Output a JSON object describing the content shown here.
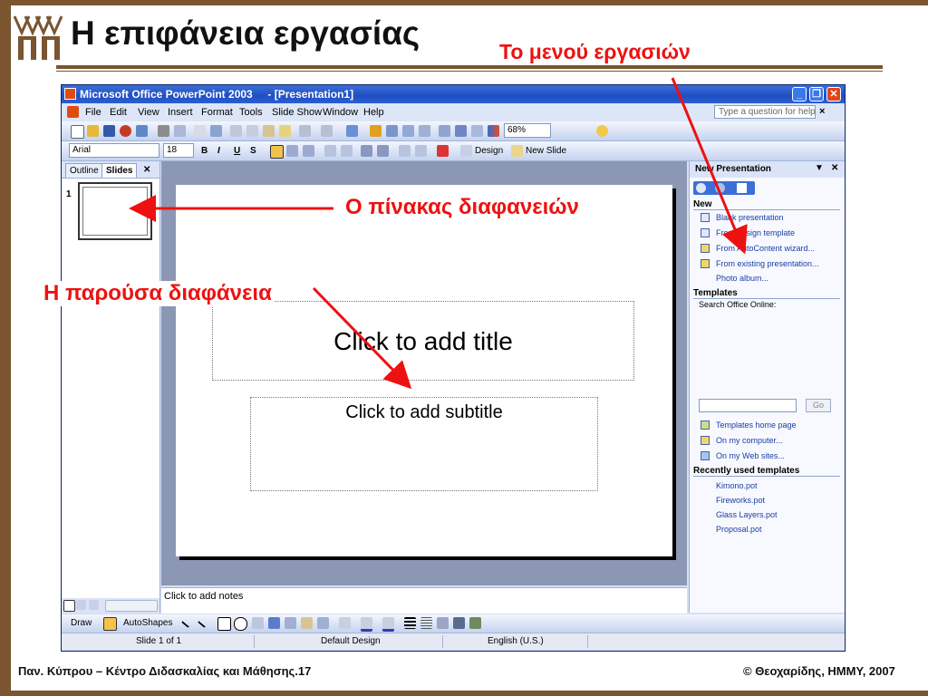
{
  "slide": {
    "heading": "Η επιφάνεια εργασίας",
    "labels": {
      "task_pane": "Το μενού εργασιών",
      "slides_pane": "Ο πίνακας διαφανειών",
      "current_slide": "Η παρούσα διαφάνεια"
    },
    "footer_left": "Παν. Κύπρου – Κέντρο Διδασκαλίας και Μάθησης.17",
    "footer_right": "© Θεοχαρίδης, ΗΜΜΥ, 2007",
    "colors": {
      "frame": "#7a5530",
      "annotation": "#ee1111"
    }
  },
  "window": {
    "title": "Microsoft Office PowerPoint 2003",
    "document": "- [Presentation1]",
    "buttons": [
      "minimize-icon",
      "restore-icon",
      "close-icon"
    ]
  },
  "menubar": {
    "items": [
      "File",
      "Edit",
      "View",
      "Insert",
      "Format",
      "Tools",
      "Slide Show",
      "Window",
      "Help"
    ],
    "help_placeholder": "Type a question for help",
    "close": "×"
  },
  "standard_toolbar": {
    "zoom": "68%"
  },
  "formatting_toolbar": {
    "font": "Arial",
    "size": "18",
    "bold": "B",
    "italic": "I",
    "underline": "U",
    "shadow": "S",
    "design": "Design",
    "new_slide": "New Slide"
  },
  "left_pane": {
    "tabs": [
      "Outline",
      "Slides"
    ],
    "close": "✕",
    "thumb_number": "1"
  },
  "editor": {
    "title_placeholder": "Click to add title",
    "subtitle_placeholder": "Click to add subtitle",
    "notes_placeholder": "Click to add notes"
  },
  "task_pane": {
    "title": "New Presentation",
    "sections": {
      "new": {
        "heading": "New",
        "items": [
          "Blank presentation",
          "From design template",
          "From AutoContent wizard...",
          "From existing presentation...",
          "Photo album..."
        ]
      },
      "templates": {
        "heading": "Templates",
        "search_label": "Search Office Online:",
        "go": "Go",
        "items": [
          "Templates home page",
          "On my computer...",
          "On my Web sites..."
        ]
      },
      "recent": {
        "heading": "Recently used templates",
        "items": [
          "Kimono.pot",
          "Fireworks.pot",
          "Glass Layers.pot",
          "Proposal.pot"
        ]
      }
    }
  },
  "draw_toolbar": {
    "draw": "Draw",
    "autoshapes": "AutoShapes"
  },
  "status_bar": {
    "slide": "Slide 1 of 1",
    "design": "Default Design",
    "language": "English (U.S.)"
  }
}
